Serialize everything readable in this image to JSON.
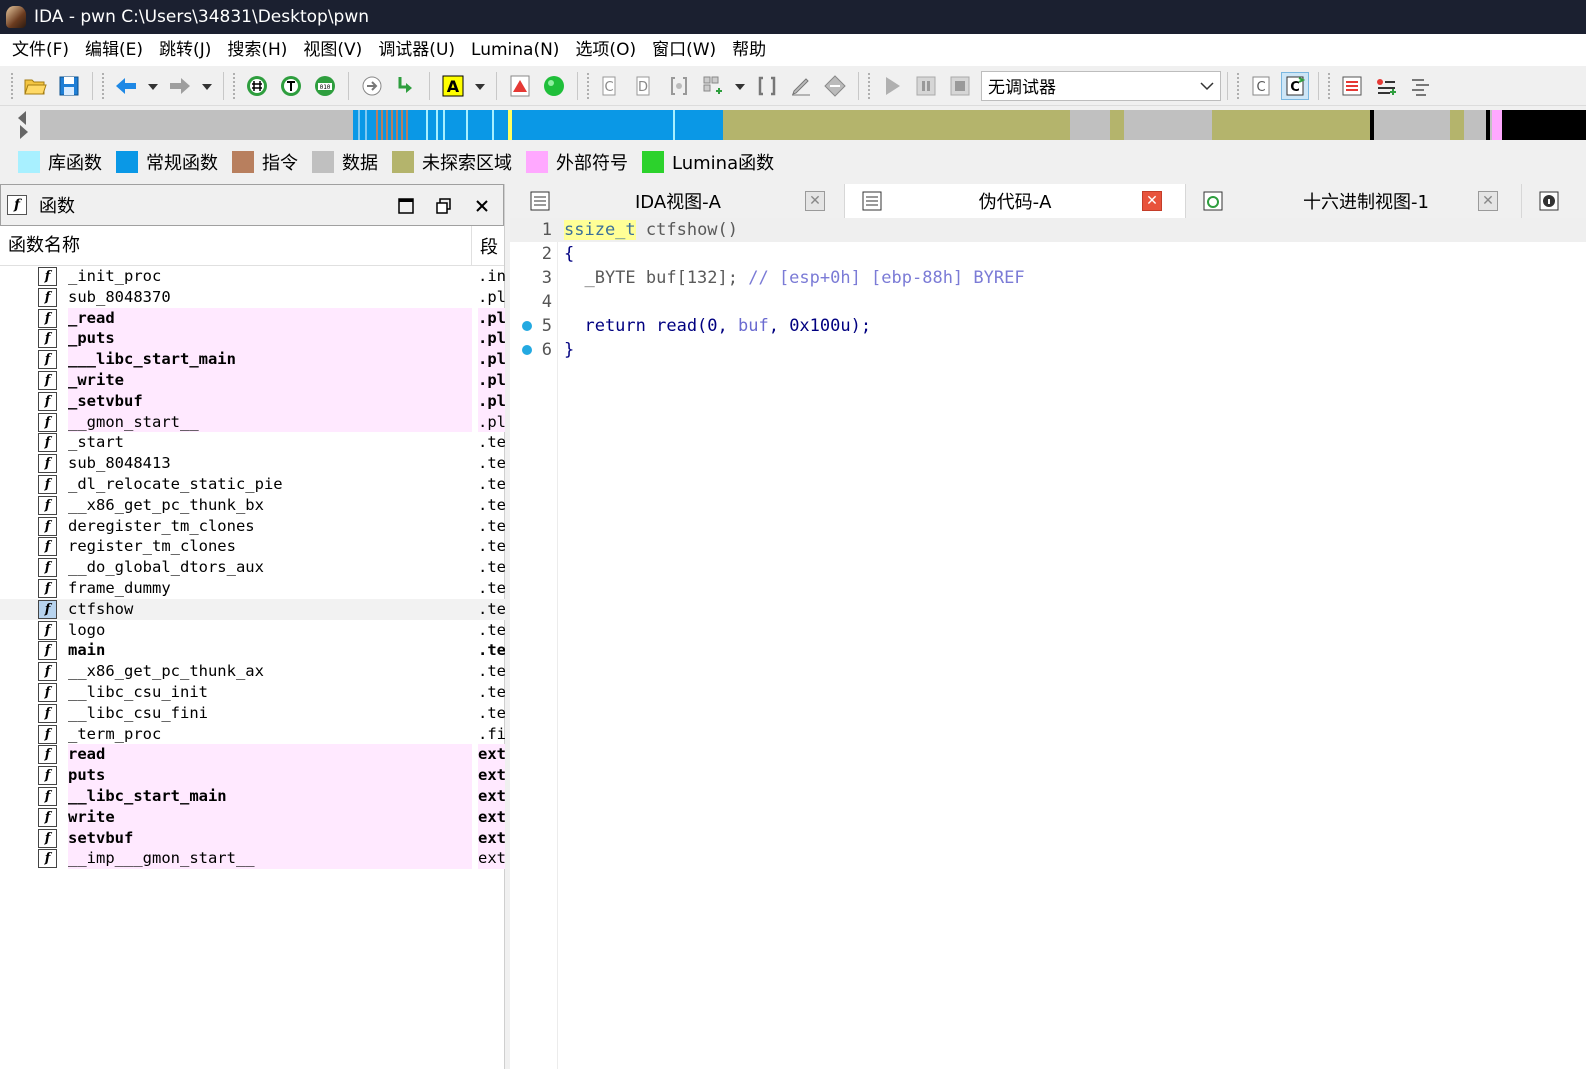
{
  "window": {
    "title": "IDA - pwn C:\\Users\\34831\\Desktop\\pwn"
  },
  "menu": [
    "文件(F)",
    "编辑(E)",
    "跳转(J)",
    "搜索(H)",
    "视图(V)",
    "调试器(U)",
    "Lumina(N)",
    "选项(O)",
    "窗口(W)",
    "帮助"
  ],
  "toolbar": {
    "debugger_select": "无调试器"
  },
  "legend": [
    {
      "label": "库函数",
      "color": "#a8f0ff"
    },
    {
      "label": "常规函数",
      "color": "#0a98e6"
    },
    {
      "label": "指令",
      "color": "#b87f5e"
    },
    {
      "label": "数据",
      "color": "#c0c0c0"
    },
    {
      "label": "未探索区域",
      "color": "#b4b46c"
    },
    {
      "label": "外部符号",
      "color": "#ffa8ff"
    },
    {
      "label": "Lumina函数",
      "color": "#2cd22c"
    }
  ],
  "functions_panel": {
    "title": "函数",
    "col_name": "函数名称",
    "col_segment": "段",
    "rows": [
      {
        "name": "_init_proc",
        "segment": ".init",
        "pink": false,
        "bold": false
      },
      {
        "name": "sub_8048370",
        "segment": ".plt",
        "pink": false,
        "bold": false
      },
      {
        "name": "_read",
        "segment": ".plt",
        "pink": true,
        "bold": true
      },
      {
        "name": "_puts",
        "segment": ".plt",
        "pink": true,
        "bold": true
      },
      {
        "name": "___libc_start_main",
        "segment": ".plt",
        "pink": true,
        "bold": true
      },
      {
        "name": "_write",
        "segment": ".plt",
        "pink": true,
        "bold": true
      },
      {
        "name": "_setvbuf",
        "segment": ".plt",
        "pink": true,
        "bold": true
      },
      {
        "name": "__gmon_start__",
        "segment": ".plt",
        "pink": true,
        "bold": false
      },
      {
        "name": "_start",
        "segment": ".text",
        "pink": false,
        "bold": false
      },
      {
        "name": "sub_8048413",
        "segment": ".text",
        "pink": false,
        "bold": false
      },
      {
        "name": "_dl_relocate_static_pie",
        "segment": ".text",
        "pink": false,
        "bold": false
      },
      {
        "name": "__x86_get_pc_thunk_bx",
        "segment": ".text",
        "pink": false,
        "bold": false
      },
      {
        "name": "deregister_tm_clones",
        "segment": ".text",
        "pink": false,
        "bold": false
      },
      {
        "name": "register_tm_clones",
        "segment": ".text",
        "pink": false,
        "bold": false
      },
      {
        "name": "__do_global_dtors_aux",
        "segment": ".text",
        "pink": false,
        "bold": false
      },
      {
        "name": "frame_dummy",
        "segment": ".text",
        "pink": false,
        "bold": false
      },
      {
        "name": "ctfshow",
        "segment": ".text",
        "pink": false,
        "bold": false,
        "selected": true
      },
      {
        "name": "logo",
        "segment": ".text",
        "pink": false,
        "bold": false
      },
      {
        "name": "main",
        "segment": ".text",
        "pink": false,
        "bold": true
      },
      {
        "name": "__x86_get_pc_thunk_ax",
        "segment": ".text",
        "pink": false,
        "bold": false
      },
      {
        "name": "__libc_csu_init",
        "segment": ".text",
        "pink": false,
        "bold": false
      },
      {
        "name": "__libc_csu_fini",
        "segment": ".text",
        "pink": false,
        "bold": false
      },
      {
        "name": "_term_proc",
        "segment": ".fini",
        "pink": false,
        "bold": false
      },
      {
        "name": "read",
        "segment": "extern",
        "pink": true,
        "bold": true
      },
      {
        "name": "puts",
        "segment": "extern",
        "pink": true,
        "bold": true
      },
      {
        "name": "__libc_start_main",
        "segment": "extern",
        "pink": true,
        "bold": true
      },
      {
        "name": "write",
        "segment": "extern",
        "pink": true,
        "bold": true
      },
      {
        "name": "setvbuf",
        "segment": "extern",
        "pink": true,
        "bold": true
      },
      {
        "name": "__imp___gmon_start__",
        "segment": "extern",
        "pink": true,
        "bold": false
      }
    ]
  },
  "tabs": [
    {
      "label": "IDA视图-A",
      "active": false
    },
    {
      "label": "伪代码-A",
      "active": true
    },
    {
      "label": "十六进制视图-1",
      "active": false
    }
  ],
  "code": {
    "lines": [
      {
        "no": "1",
        "breakpoint": false
      },
      {
        "no": "2",
        "breakpoint": false
      },
      {
        "no": "3",
        "breakpoint": false
      },
      {
        "no": "4",
        "breakpoint": false
      },
      {
        "no": "5",
        "breakpoint": true
      },
      {
        "no": "6",
        "breakpoint": true
      }
    ],
    "line1_type": "ssize_t",
    "line1_rest": " ctfshow()",
    "line2": "{",
    "line3_code": "  _BYTE buf[132]; ",
    "line3_comment": "// [esp+0h] [ebp-88h] BYREF",
    "line5_a": "  return read(0, ",
    "line5_var": "buf",
    "line5_b": ", 0x100u);",
    "line6": "}"
  }
}
